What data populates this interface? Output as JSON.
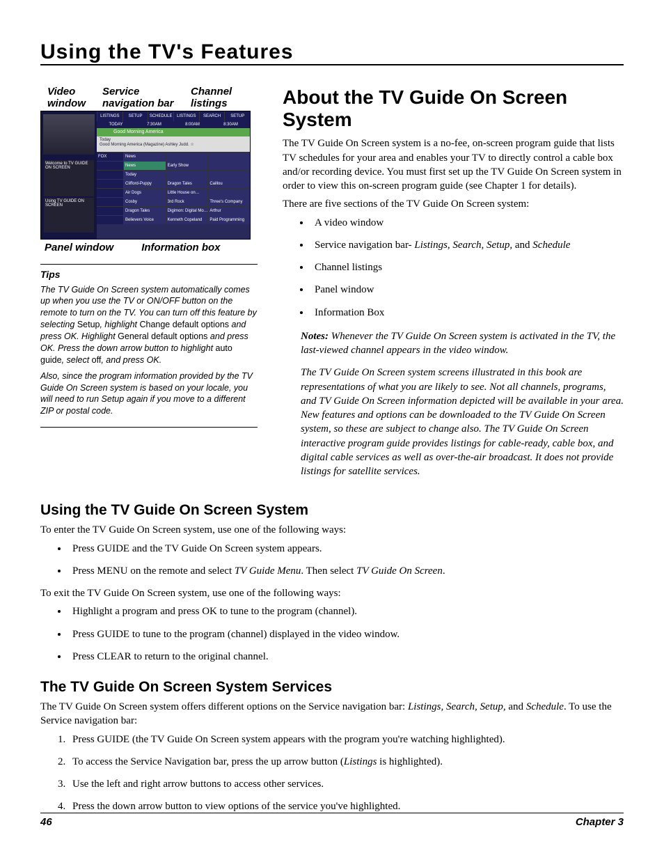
{
  "chapterTitle": "Using the TV's Features",
  "callouts": {
    "topLeft": "Video window",
    "topMid": "Service navigation bar",
    "topRight": "Channel listings",
    "botLeft": "Panel window",
    "botRight": "Information box"
  },
  "diagram": {
    "nav": [
      "LISTINGS",
      "SETUP",
      "SCHEDULE",
      "LISTINGS",
      "SEARCH",
      "SETUP"
    ],
    "times": [
      "TODAY",
      "7:30AM",
      "8:00AM",
      "8:30AM"
    ],
    "highlightShow": "Good Morning America",
    "infoLine1": "Today",
    "infoLine2": "Good Morning America (Magazine) Ashley Judd. ☆",
    "rows": [
      {
        "ch": "FOX",
        "cells": [
          "News",
          "",
          ""
        ]
      },
      {
        "ch": "",
        "cells": [
          "News",
          "Early Show",
          ""
        ]
      },
      {
        "ch": "",
        "cells": [
          "Today",
          "",
          ""
        ]
      },
      {
        "ch": "",
        "cells": [
          "Clifford-Puppy",
          "Dragon Tales",
          "Caillou"
        ]
      },
      {
        "ch": "",
        "cells": [
          "Air Dogs",
          "Little House on…",
          ""
        ]
      },
      {
        "ch": "",
        "cells": [
          "Cosby",
          "3rd Rock",
          "Three's Company"
        ]
      },
      {
        "ch": "",
        "cells": [
          "Dragon Tales",
          "Digimon: Digital Mo…",
          "Arthur"
        ]
      },
      {
        "ch": "",
        "cells": [
          "Believers Voice",
          "Kenneth Copeland",
          "Paid Programming"
        ]
      }
    ],
    "promo1": "Welcome to TV GUIDE ON SCREEN",
    "promo2": "Using TV GUIDE ON SCREEN"
  },
  "tips": {
    "heading": "Tips",
    "para1_a": "The TV Guide On Screen system automatically comes up when you use the TV or ON/OFF button on the remote to turn on the TV. You can turn off this feature by selecting ",
    "para1_b": "Setup",
    "para1_c": ", highlight ",
    "para1_d": "Change default options",
    "para1_e": " and press OK. Highlight ",
    "para1_f": "General default options",
    "para1_g": " and press OK. Press the down arrow button to highlight ",
    "para1_h": "auto guide",
    "para1_i": ", select ",
    "para1_j": "off",
    "para1_k": ", and press OK.",
    "para2": "Also, since the program information provided by the TV Guide On Screen system is based on your locale, you will need to run Setup again if you move to a different ZIP or postal code."
  },
  "mainHeading": "About the TV Guide On Screen System",
  "intro": "The TV Guide On Screen system is a no-fee, on-screen program guide that lists TV schedules for your area and enables your TV to directly control a cable box and/or recording device. You must first set up the TV Guide On Screen system in order to view this on-screen program guide (see Chapter 1 for details).",
  "sectionsLead": "There are five sections of the TV Guide On Screen system:",
  "sections": {
    "b1": "A video window",
    "b2_a": "Service navigation bar- ",
    "b2_b": "Listings, Search, Setup,",
    "b2_c": " and ",
    "b2_d": "Schedule",
    "b3": "Channel listings",
    "b4": "Panel window",
    "b5": "Information Box"
  },
  "notes": {
    "lead": "Notes:",
    "n1": " Whenever the TV Guide On Screen system is activated in the TV, the last-viewed channel appears in the video window.",
    "n2": "The TV Guide On Screen system screens illustrated in this book are representations of what you are likely to see. Not all channels, programs, and TV Guide On Screen information depicted will be available in your area. New features and options can be downloaded to the TV Guide On Screen system, so these are subject to change also. The TV Guide On Screen interactive program guide provides listings for cable-ready, cable box, and digital cable services as well as over-the-air broadcast. It does not provide listings for satellite services."
  },
  "using": {
    "heading": "Using the TV Guide On Screen System",
    "enterLead": "To enter the TV Guide On Screen system, use one of the following ways:",
    "e1": "Press GUIDE and the TV Guide On Screen system appears.",
    "e2_a": "Press MENU on the remote and select ",
    "e2_b": "TV Guide Menu",
    "e2_c": ". Then select ",
    "e2_d": "TV Guide On Screen",
    "e2_e": ".",
    "exitLead": "To exit the TV Guide On Screen system, use one of the following ways:",
    "x1": "Highlight a program and press OK to tune to the program (channel).",
    "x2": "Press GUIDE to tune to the program (channel) displayed in the video window.",
    "x3": "Press CLEAR to return to the original channel."
  },
  "services": {
    "heading": "The TV Guide On Screen System Services",
    "lead_a": "The TV Guide On Screen system offers different options on the Service navigation bar: ",
    "lead_b": "Listings, Search, Setup,",
    "lead_c": " and ",
    "lead_d": "Schedule",
    "lead_e": ". To use the Service navigation bar:",
    "s1": "Press GUIDE (the TV Guide On Screen system appears with the program you're watching highlighted).",
    "s2_a": "To access the Service Navigation bar, press the up arrow button (",
    "s2_b": "Listings",
    "s2_c": " is highlighted).",
    "s3": "Use the left and right arrow buttons to access other services.",
    "s4": "Press the down arrow button to view options of the service you've highlighted."
  },
  "footer": {
    "page": "46",
    "chapter": "Chapter 3"
  }
}
